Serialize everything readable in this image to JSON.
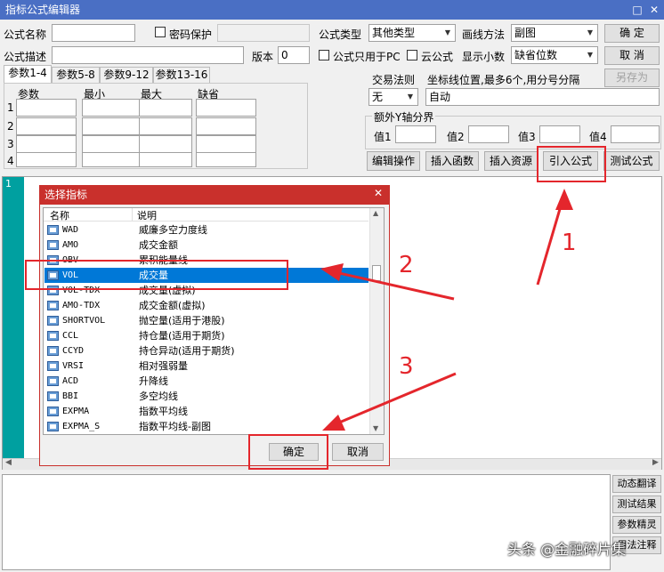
{
  "window": {
    "title": "指标公式编辑器",
    "restore_icon": "□",
    "close_icon": "✕"
  },
  "form": {
    "formula_name_label": "公式名称",
    "password_label": "密码保护",
    "formula_desc_label": "公式描述",
    "version_label": "版本",
    "version_value": "0",
    "pc_only_label": "公式只用于PC",
    "cloud_label": "云公式",
    "decimals_label": "显示小数",
    "decimals_value": "缺省位数",
    "type_label": "公式类型",
    "type_value": "其他类型",
    "draw_label": "画线方法",
    "draw_value": "副图"
  },
  "buttons": {
    "ok": "确  定",
    "cancel": "取  消",
    "save_as": "另存为",
    "edit_ops": "编辑操作",
    "insert_func": "插入函数",
    "insert_res": "插入资源",
    "import_formula": "引入公式",
    "test_formula": "测试公式",
    "dynamic_translate": "动态翻译",
    "test_result": "测试结果",
    "param_tuning": "参数精灵",
    "usage_note": "用法注释"
  },
  "tabs": [
    "参数1-4",
    "参数5-8",
    "参数9-12",
    "参数13-16"
  ],
  "params": {
    "headers": [
      "参数",
      "最小",
      "最大",
      "缺省"
    ],
    "rows": [
      "1",
      "2",
      "3",
      "4"
    ]
  },
  "trade_rule_label": "交易法则",
  "trade_rule_value": "无",
  "coord_label": "坐标线位置,最多6个,用分号分隔",
  "coord_value": "自动",
  "yaxis": {
    "label": "额外Y轴分界",
    "v1": "值1",
    "v2": "值2",
    "v3": "值3",
    "v4": "值4"
  },
  "editor": {
    "line_no": "1"
  },
  "dialog": {
    "title": "选择指标",
    "close_icon": "✕",
    "col_name": "名称",
    "col_desc": "说明",
    "items": [
      {
        "name": "WAD",
        "desc": "威廉多空力度线"
      },
      {
        "name": "AMO",
        "desc": "成交金额"
      },
      {
        "name": "OBV",
        "desc": "累积能量线"
      },
      {
        "name": "VOL",
        "desc": "成交量"
      },
      {
        "name": "VOL-TDX",
        "desc": "成交量(虚拟)"
      },
      {
        "name": "AMO-TDX",
        "desc": "成交金额(虚拟)"
      },
      {
        "name": "SHORTVOL",
        "desc": "抛空量(适用于港股)"
      },
      {
        "name": "CCL",
        "desc": "持仓量(适用于期货)"
      },
      {
        "name": "CCYD",
        "desc": "持仓异动(适用于期货)"
      },
      {
        "name": "VRSI",
        "desc": "相对强弱量"
      },
      {
        "name": "ACD",
        "desc": "升降线"
      },
      {
        "name": "BBI",
        "desc": "多空均线"
      },
      {
        "name": "EXPMA",
        "desc": "指数平均线"
      },
      {
        "name": "EXPMA_S",
        "desc": "指数平均线-副图"
      }
    ],
    "selected_index": 3,
    "ok": "确定",
    "cancel": "取消"
  },
  "annotations": {
    "n1": "1",
    "n2": "2",
    "n3": "3"
  },
  "watermark": "头条 @金融碎片集",
  "colors": {
    "titlebar": "#4a6fc4",
    "dialog_title": "#c9302c",
    "selection": "#0078d7",
    "annotation": "#e4262c",
    "editor_gutter": "#00a0a0"
  }
}
